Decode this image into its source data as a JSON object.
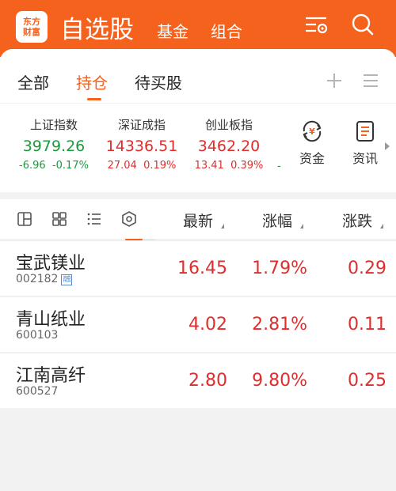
{
  "header": {
    "logo_line1": "东方",
    "logo_line2": "财富",
    "title": "自选股",
    "tabs": [
      "基金",
      "组合"
    ],
    "icons": [
      "settings-list-icon",
      "search-icon"
    ]
  },
  "subtabs": {
    "items": [
      "全部",
      "持仓",
      "待买股"
    ],
    "active": "持仓",
    "icons": [
      "plus-icon",
      "menu-icon"
    ]
  },
  "indices": [
    {
      "name": "上证指数",
      "value": "3979.26",
      "change": "-6.96",
      "pct": "-0.17%",
      "color": "#1b9b3e"
    },
    {
      "name": "深证成指",
      "value": "14336.51",
      "change": "27.04",
      "pct": "0.19%",
      "color": "#e02d2d"
    },
    {
      "name": "创业板指",
      "value": "3462.20",
      "change": "13.41",
      "pct": "0.39%",
      "color": "#e02d2d"
    }
  ],
  "index_overflow": "-",
  "quick_actions": [
    {
      "label": "资金",
      "icon": "money-flow-icon"
    },
    {
      "label": "资讯",
      "icon": "news-icon"
    }
  ],
  "list": {
    "columns": [
      "最新",
      "涨幅",
      "涨跌"
    ],
    "view_icons": [
      "split-view-icon",
      "grid-view-icon",
      "list-view-icon",
      "target-icon"
    ],
    "rows": [
      {
        "name": "宝武镁业",
        "code": "002182",
        "badge": "融",
        "price": "16.45",
        "pct": "1.79%",
        "change": "0.29"
      },
      {
        "name": "青山纸业",
        "code": "600103",
        "badge": "",
        "price": "4.02",
        "pct": "2.81%",
        "change": "0.11"
      },
      {
        "name": "江南高纤",
        "code": "600527",
        "badge": "",
        "price": "2.80",
        "pct": "9.80%",
        "change": "0.25"
      }
    ]
  },
  "colors": {
    "brand": "#f5621e",
    "up": "#e02d2d",
    "down": "#1b9b3e"
  }
}
